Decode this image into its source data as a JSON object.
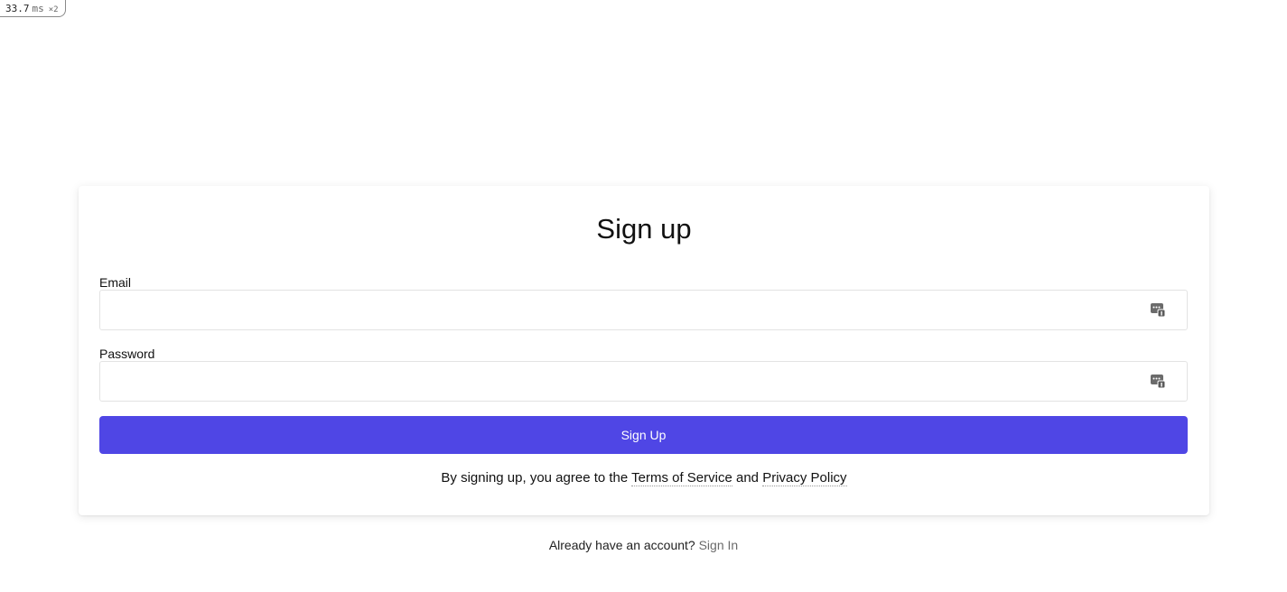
{
  "perf_badge": {
    "value": "33.7",
    "unit": "ms",
    "multiplier": "×2"
  },
  "form": {
    "title": "Sign up",
    "email_label": "Email",
    "email_value": "",
    "password_label": "Password",
    "password_value": "",
    "submit_label": "Sign Up",
    "field_icon": "password-manager-icon"
  },
  "terms": {
    "prefix": "By signing up, you agree to the ",
    "tos_link": "Terms of Service",
    "and": " and ",
    "privacy_link": "Privacy Policy"
  },
  "footer": {
    "prompt": "Already have an account? ",
    "signin_link": "Sign In"
  },
  "colors": {
    "primary_button": "#4f46e5",
    "signin_link": "#6b6b6b"
  }
}
